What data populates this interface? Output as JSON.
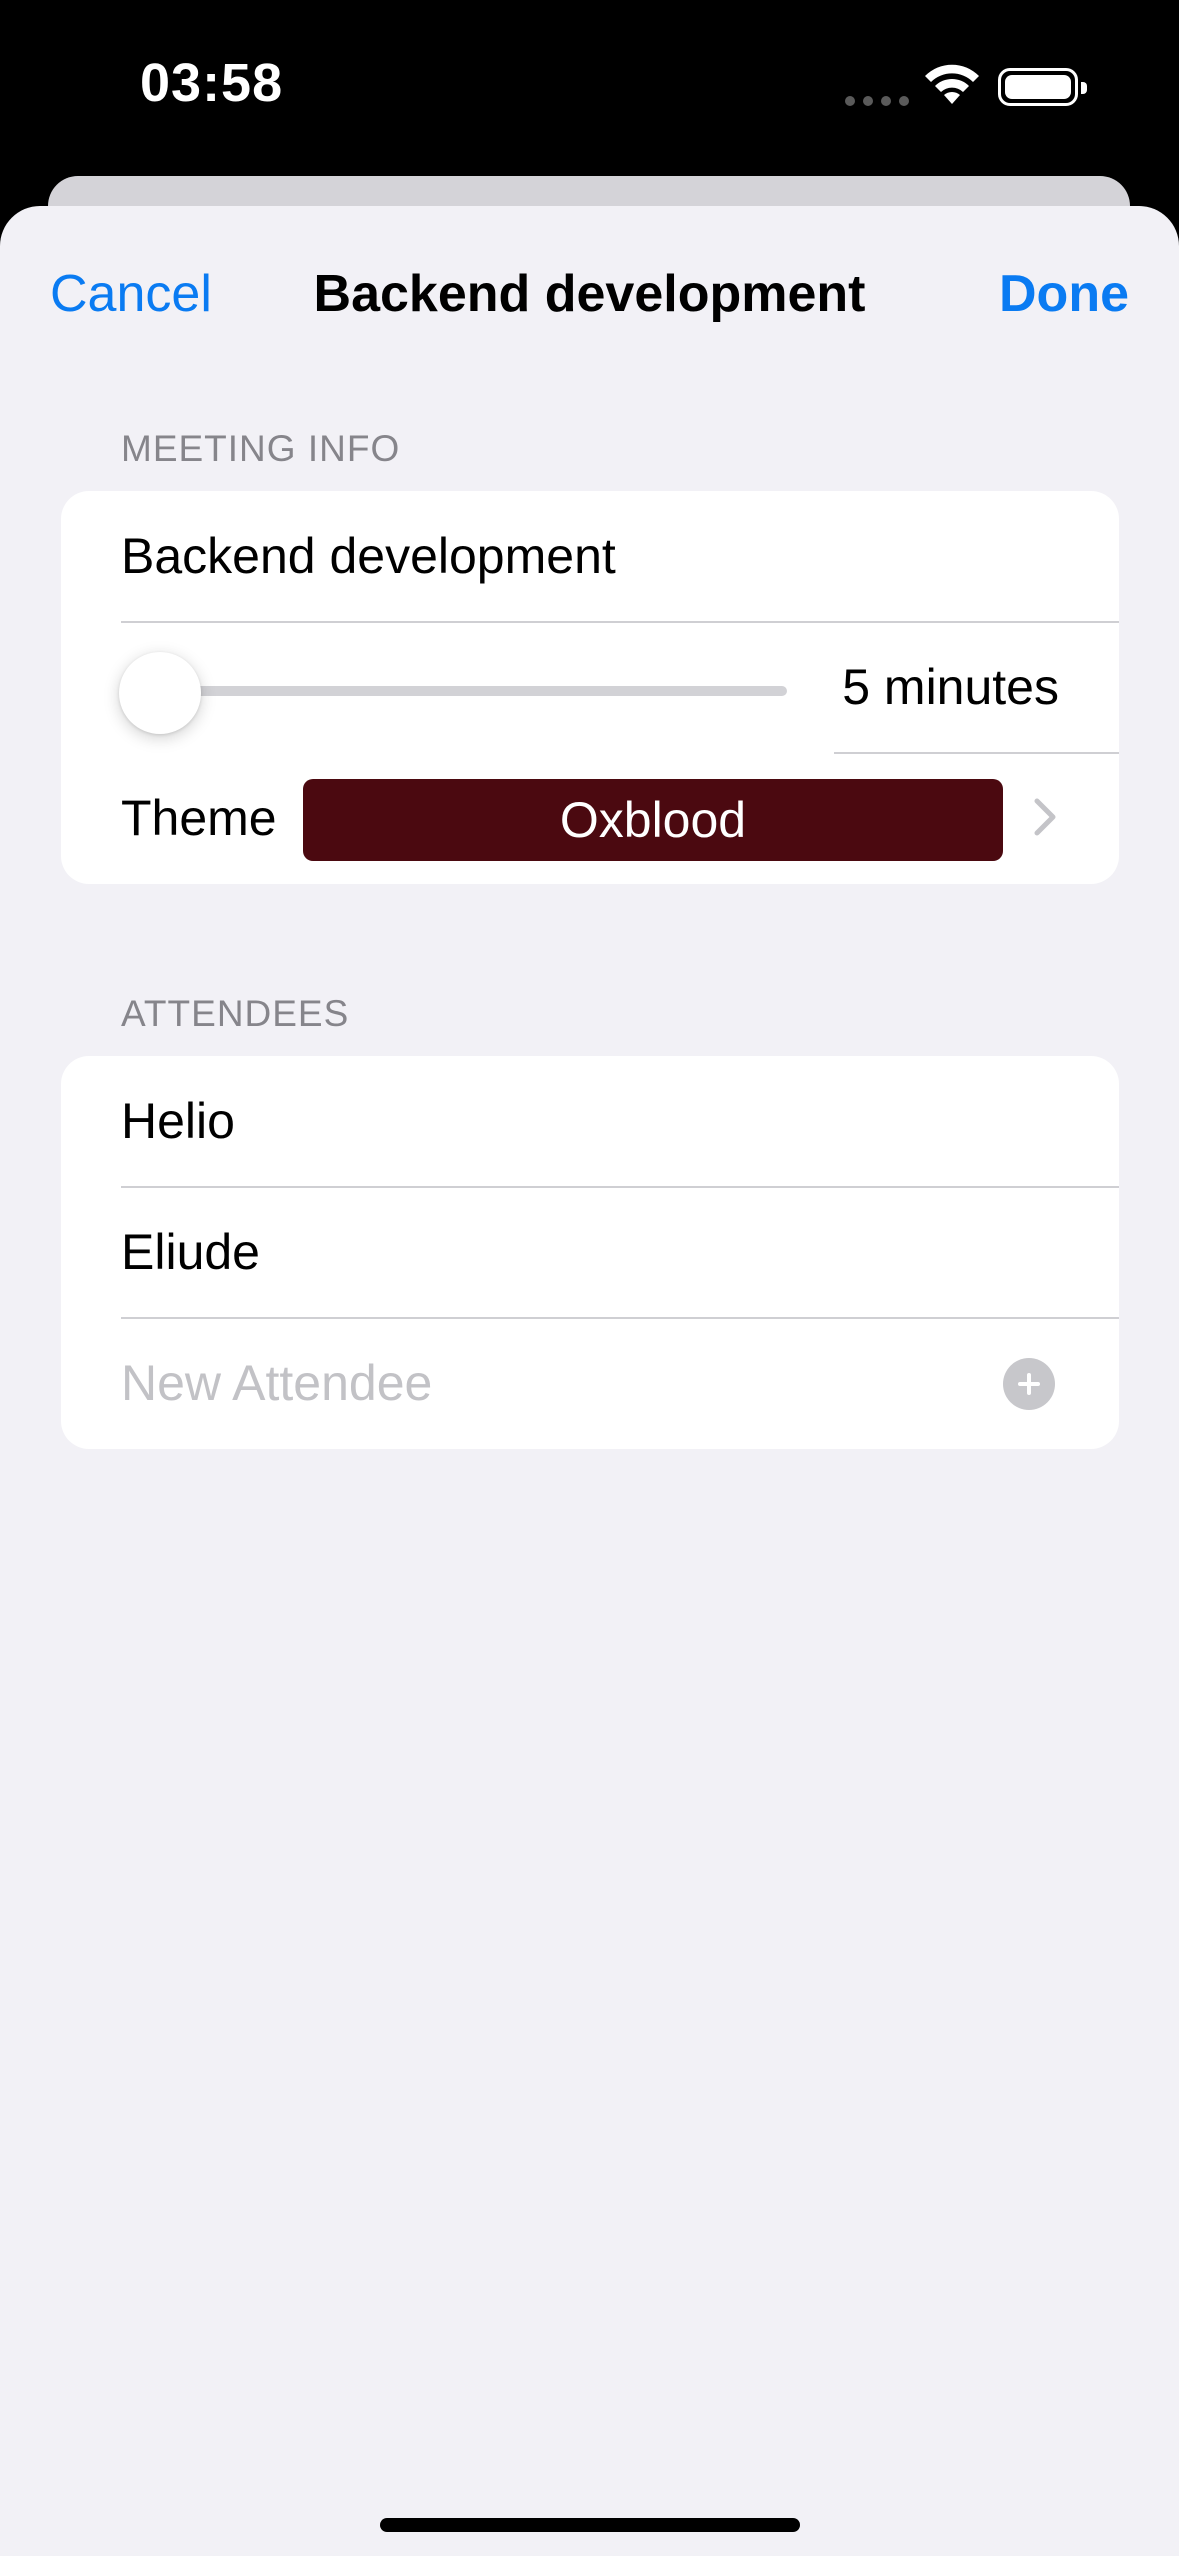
{
  "status_bar": {
    "time": "03:58"
  },
  "nav": {
    "cancel_label": "Cancel",
    "title": "Backend development",
    "done_label": "Done"
  },
  "meeting_info": {
    "header": "MEETING INFO",
    "title_value": "Backend development",
    "length_value": 0.0,
    "length_label": "5 minutes",
    "theme_label": "Theme",
    "theme_value": "Oxblood",
    "theme_color": "#4b0910"
  },
  "attendees": {
    "header": "ATTENDEES",
    "items": [
      {
        "name": "Helio"
      },
      {
        "name": "Eliude"
      }
    ],
    "new_placeholder": "New Attendee"
  },
  "colors": {
    "accent": "#0a7bf2",
    "background": "#f2f1f6"
  }
}
